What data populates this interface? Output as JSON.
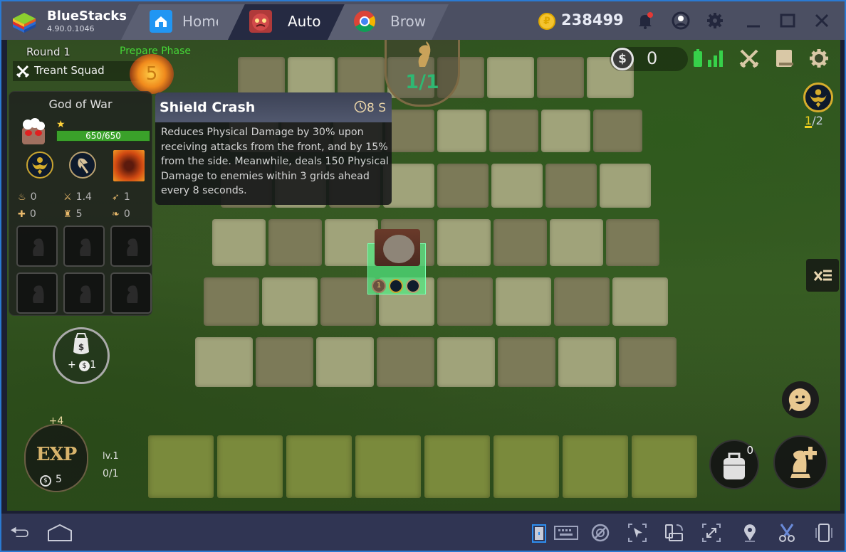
{
  "titlebar": {
    "app_name": "BlueStacks",
    "version": "4.90.0.1046",
    "tabs": [
      {
        "label": "Home",
        "icon": "home-icon",
        "active": false
      },
      {
        "label": "Auto",
        "icon": "game-mascot-icon",
        "active": true
      },
      {
        "label": "Brows",
        "icon": "chrome-icon",
        "active": false
      }
    ],
    "coin_symbol": "₽",
    "coin_count": "238499",
    "notification_badge": true
  },
  "game": {
    "round_label": "Round 1",
    "phase_label": "Prepare Phase",
    "squad_label": "Treant Squad",
    "timer_value": "5",
    "population": "1/1",
    "gold_symbol": "$",
    "gold": "0",
    "synergy": {
      "current": "1",
      "separator": "/",
      "total": "2"
    },
    "unit_panel": {
      "name": "God of War",
      "stars": 1,
      "hp": "650/650",
      "hp_fraction": 1.0,
      "stats": [
        {
          "icon": "attack-power-icon",
          "value": "0"
        },
        {
          "icon": "sword-icon",
          "value": "1.4"
        },
        {
          "icon": "bow-range-icon",
          "value": "1"
        },
        {
          "icon": "plus-icon",
          "value": "0"
        },
        {
          "icon": "armor-icon",
          "value": "5"
        },
        {
          "icon": "magic-resist-icon",
          "value": "0"
        }
      ],
      "item_slots": 6
    },
    "skill_tooltip": {
      "title": "Shield Crash",
      "cooldown": "8 S",
      "description": "Reduces Physical Damage by 30% upon receiving attacks from the front, and by 15% from the side. Meanwhile, deals 150 Physical Damage to enemies within 3 grids ahead every 8 seconds."
    },
    "sell": {
      "gain_prefix": "+",
      "gain_symbol": "$",
      "gain_value": "1"
    },
    "exp": {
      "bonus": "+4",
      "label": "EXP",
      "cost_symbol": "$",
      "cost": "5",
      "level": "lv.1",
      "progress": "0/1"
    },
    "unit_star_badge": "1",
    "bag_count": "0"
  },
  "colors": {
    "accent_blue": "#2a7ad2",
    "phase_green": "#45d637",
    "population_green": "#2fb873",
    "hp_green": "#3aa12a",
    "gold_yellow": "#f4c430"
  }
}
